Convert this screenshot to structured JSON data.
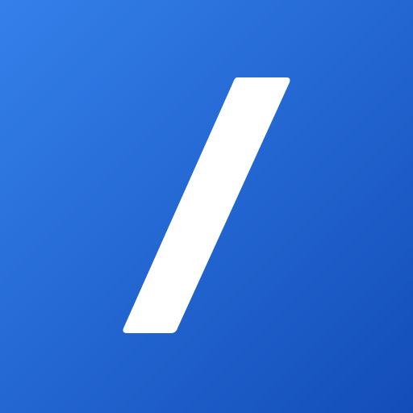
{
  "app_icon": {
    "icon_name": "slash-icon",
    "colors": {
      "gradient_start": "#3480ea",
      "gradient_end": "#134db9",
      "glyph": "#ffffff"
    }
  }
}
